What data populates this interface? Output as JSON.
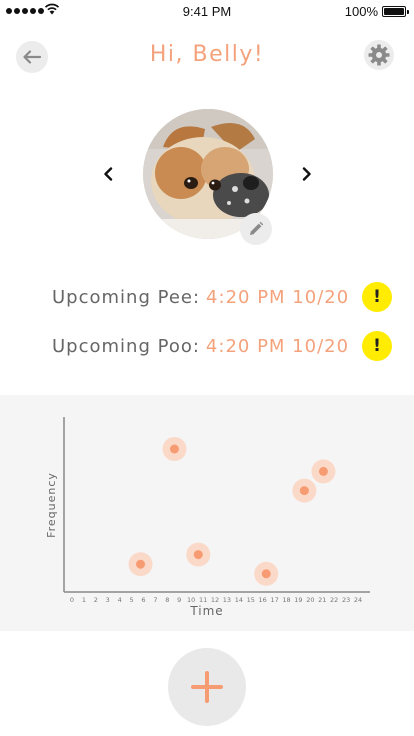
{
  "status_bar": {
    "time": "9:41 PM",
    "battery": "100%",
    "signal_icon": "signal-dots-icon",
    "wifi_icon": "wifi-icon",
    "battery_icon": "battery-icon"
  },
  "header": {
    "title": "Hi, Belly!",
    "back_icon": "arrow-left-icon",
    "settings_icon": "gear-icon"
  },
  "profile": {
    "photo": "dog-photo",
    "prev_icon": "chevron-left-icon",
    "next_icon": "chevron-right-icon",
    "edit_icon": "pencil-icon"
  },
  "upcoming": [
    {
      "label": "Upcoming Pee",
      "value": "4:20 PM 10/20",
      "alert": "!"
    },
    {
      "label": "Upcoming Poo",
      "value": "4:20 PM 10/20",
      "alert": "!"
    }
  ],
  "chart_data": {
    "type": "scatter",
    "xlabel": "Time",
    "ylabel": "Frequency",
    "x_ticks": [
      "0",
      "1",
      "2",
      "3",
      "4",
      "5",
      "6",
      "7",
      "8",
      "9",
      "10",
      "11",
      "12",
      "13",
      "14",
      "15",
      "16",
      "17",
      "18",
      "19",
      "20",
      "21",
      "22",
      "23",
      "24"
    ],
    "xlim": [
      0,
      24
    ],
    "ylim": [
      0,
      10
    ],
    "grid": false,
    "points": [
      {
        "x": 5.75,
        "y": 1.3
      },
      {
        "x": 8.6,
        "y": 8.5
      },
      {
        "x": 10.6,
        "y": 1.9
      },
      {
        "x": 16.3,
        "y": 0.7
      },
      {
        "x": 19.5,
        "y": 5.9
      },
      {
        "x": 21.1,
        "y": 7.1
      }
    ],
    "point_color": "#f79c72",
    "halo_color": "#fbd9c8"
  },
  "actions": {
    "add_icon": "plus-icon"
  },
  "colors": {
    "accent": "#f4a27c",
    "alert": "#ffec00",
    "button_bg": "#ececec"
  }
}
